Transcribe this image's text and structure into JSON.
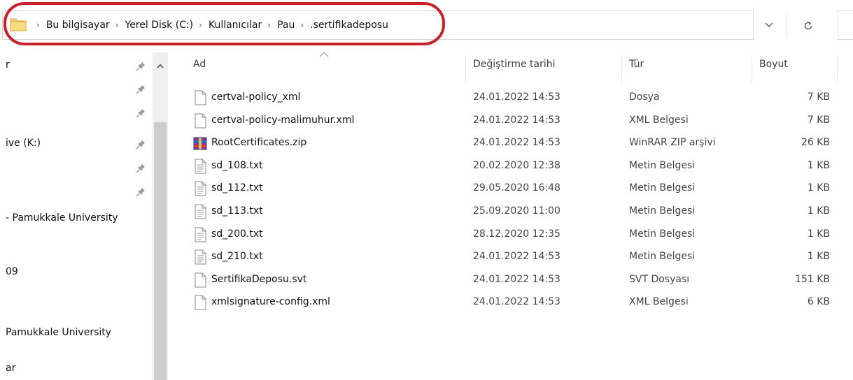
{
  "breadcrumb": [
    "Bu bilgisayar",
    "Yerel Disk (C:)",
    "Kullanıcılar",
    "Pau",
    ".sertifikadeposu"
  ],
  "navigation": {
    "items": [
      {
        "label": "r",
        "pinned": true
      },
      {
        "label": "",
        "pinned": true
      },
      {
        "label": "",
        "pinned": true
      },
      {
        "label": "ive (K:)",
        "pinned": true
      },
      {
        "label": "",
        "pinned": true
      },
      {
        "label": "",
        "pinned": true
      },
      {
        "label": "- Pamukkale University",
        "pinned": false
      },
      {
        "label": "09",
        "pinned": false
      },
      {
        "label": "Pamukkale University",
        "pinned": false
      },
      {
        "label": "ar",
        "pinned": false
      }
    ]
  },
  "columns": {
    "name": "Ad",
    "date": "Değiştirme tarihi",
    "type": "Tür",
    "size": "Boyut"
  },
  "files": [
    {
      "name": "certval-policy_xml",
      "date": "24.01.2022 14:53",
      "type": "Dosya",
      "size": "7 KB",
      "icon": "blank-file-icon"
    },
    {
      "name": "certval-policy-malimuhur.xml",
      "date": "24.01.2022 14:53",
      "type": "XML Belgesi",
      "size": "7 KB",
      "icon": "blank-file-icon"
    },
    {
      "name": "RootCertificates.zip",
      "date": "24.01.2022 14:53",
      "type": "WinRAR ZIP arşivi",
      "size": "26 KB",
      "icon": "winrar-archive-icon"
    },
    {
      "name": "sd_108.txt",
      "date": "20.02.2020 12:38",
      "type": "Metin Belgesi",
      "size": "1 KB",
      "icon": "text-file-icon"
    },
    {
      "name": "sd_112.txt",
      "date": "29.05.2020 16:48",
      "type": "Metin Belgesi",
      "size": "1 KB",
      "icon": "text-file-icon"
    },
    {
      "name": "sd_113.txt",
      "date": "25.09.2020 11:00",
      "type": "Metin Belgesi",
      "size": "1 KB",
      "icon": "text-file-icon"
    },
    {
      "name": "sd_200.txt",
      "date": "28.12.2020 12:35",
      "type": "Metin Belgesi",
      "size": "1 KB",
      "icon": "text-file-icon"
    },
    {
      "name": "sd_210.txt",
      "date": "24.01.2022 14:53",
      "type": "Metin Belgesi",
      "size": "1 KB",
      "icon": "text-file-icon"
    },
    {
      "name": "SertifikaDeposu.svt",
      "date": "24.01.2022 14:53",
      "type": "SVT Dosyası",
      "size": "151 KB",
      "icon": "blank-file-icon"
    },
    {
      "name": "xmlsignature-config.xml",
      "date": "24.01.2022 14:53",
      "type": "XML Belgesi",
      "size": "6 KB",
      "icon": "blank-file-icon"
    }
  ],
  "colors": {
    "highlight": "#c8202a",
    "folder": "#e8c04a"
  }
}
